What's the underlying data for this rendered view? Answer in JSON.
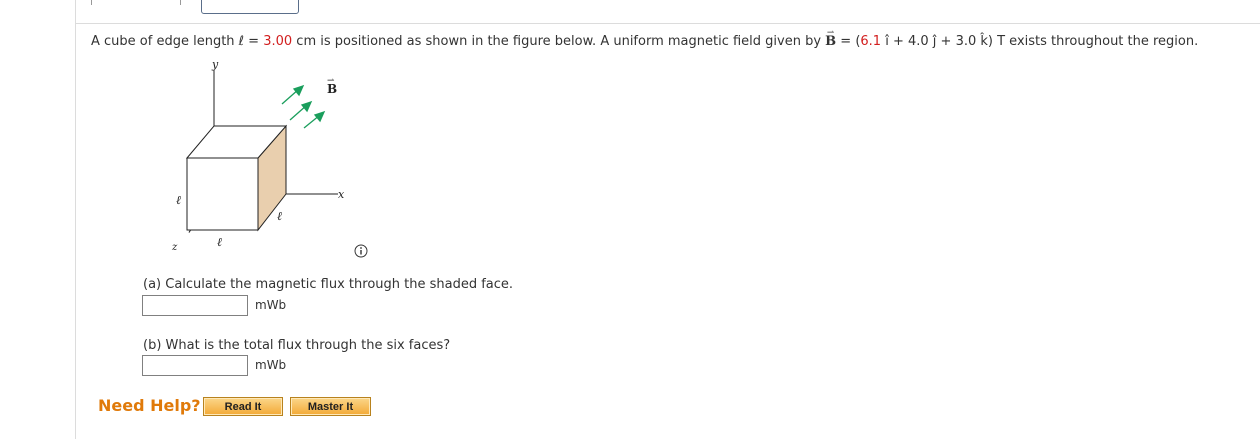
{
  "problem": {
    "text_a": "A cube of edge length ",
    "ell": "ℓ",
    "text_b": " = ",
    "edge_value": "3.00",
    "text_c": " cm is positioned as shown in the figure below. A uniform magnetic field given by ",
    "b_symbol": "B",
    "text_d": " = (",
    "bx": "6.1",
    "text_e": " î + 4.0 ĵ + 3.0 k̂) T exists throughout the region."
  },
  "figure": {
    "y_label": "y",
    "x_label": "x",
    "z_label": "z",
    "ell_left": "ℓ",
    "ell_bottom": "ℓ",
    "ell_right": "ℓ",
    "b_label": "B",
    "arrow_color": "#1a9e5c",
    "shade_color": "#e9cfae"
  },
  "part_a": {
    "question": "(a) Calculate the magnetic flux through the shaded face.",
    "value": "",
    "unit": "mWb"
  },
  "part_b": {
    "question": "(b) What is the total flux through the six faces?",
    "value": "",
    "unit": "mWb"
  },
  "help": {
    "label": "Need Help?",
    "read_it": "Read It",
    "master_it": "Master It"
  },
  "icons": {
    "info": "info-icon"
  }
}
